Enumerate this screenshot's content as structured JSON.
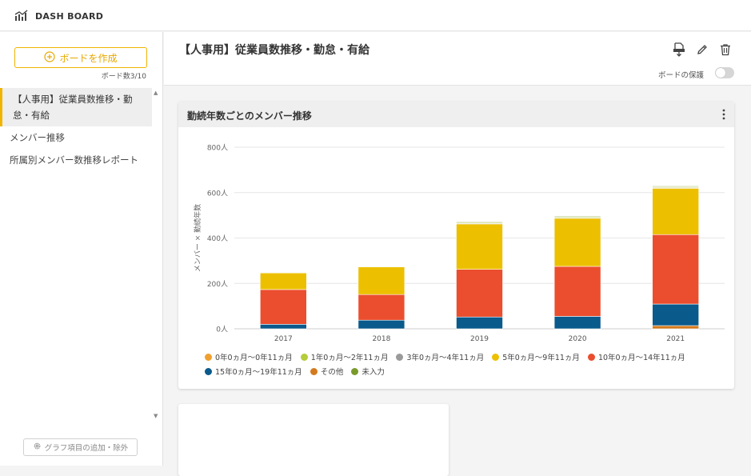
{
  "app": {
    "title": "DASH BOARD"
  },
  "sidebar": {
    "new_board_label": "ボードを作成",
    "board_count": "ボード数3/10",
    "boards": [
      {
        "label": "【人事用】従業員数推移・勤怠・有給"
      },
      {
        "label": "メンバー推移"
      },
      {
        "label": "所属別メンバー数推移レポート"
      }
    ],
    "add_graph_label": "グラフ項目の追加・除外"
  },
  "header": {
    "title": "【人事用】従業員数推移・勤怠・有給",
    "protect_label": "ボードの保護",
    "protect_on": false
  },
  "card": {
    "title": "勤続年数ごとのメンバー推移"
  },
  "chart_data": {
    "type": "bar",
    "stacked": true,
    "title": "勤続年数ごとのメンバー推移",
    "ylabel": "メンバー × 勤続年数",
    "xlabel": "",
    "categories": [
      "2017",
      "2018",
      "2019",
      "2020",
      "2021"
    ],
    "ylim": [
      0,
      800
    ],
    "yticks": [
      "0人",
      "200人",
      "400人",
      "600人",
      "800人"
    ],
    "grid": true,
    "legend_position": "bottom",
    "series": [
      {
        "name": "0年0ヵ月〜0年11ヵ月",
        "color": "#f0a030",
        "values": [
          0,
          0,
          0,
          0,
          0
        ]
      },
      {
        "name": "1年0ヵ月〜2年11ヵ月",
        "color": "#b5cc3c",
        "values": [
          2,
          2,
          4,
          4,
          4
        ]
      },
      {
        "name": "3年0ヵ月〜4年11ヵ月",
        "color": "#9a9a9a",
        "values": [
          2,
          2,
          3,
          3,
          3
        ]
      },
      {
        "name": "5年0ヵ月〜9年11ヵ月",
        "color": "#ecc000",
        "values": [
          73,
          122,
          200,
          212,
          204
        ]
      },
      {
        "name": "10年0ヵ月〜14年11ヵ月",
        "color": "#eb4e2e",
        "values": [
          153,
          113,
          210,
          220,
          306
        ]
      },
      {
        "name": "15年0ヵ月〜19年11ヵ月",
        "color": "#0a5a8c",
        "values": [
          20,
          38,
          52,
          55,
          95
        ]
      },
      {
        "name": "その他",
        "color": "#d37a1e",
        "values": [
          0,
          0,
          0,
          0,
          14
        ]
      },
      {
        "name": "未入力",
        "color": "#7a9a2c",
        "values": [
          2,
          2,
          3,
          3,
          3
        ]
      }
    ]
  }
}
